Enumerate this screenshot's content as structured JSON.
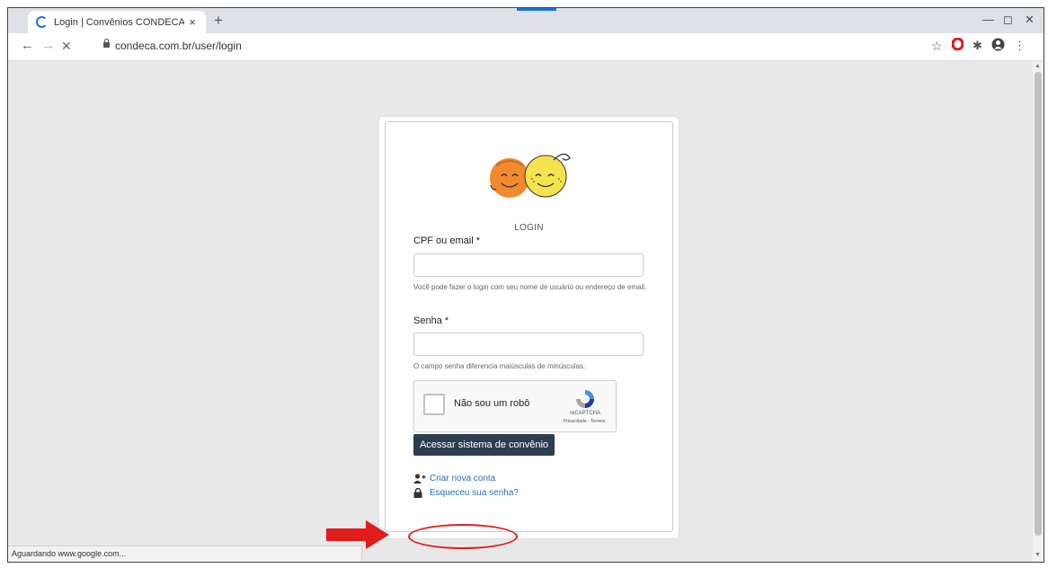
{
  "browser": {
    "tab_title": "Login | Convênios CONDECA",
    "tab_close": "×",
    "new_tab": "+",
    "url": "condeca.com.br/user/login",
    "status_text": "Aguardando www.google.com..."
  },
  "login": {
    "heading": "LOGIN",
    "cpf_label": "CPF ou email *",
    "cpf_value": "",
    "cpf_help": "Você pode fazer o login com seu nome de usuário ou endereço de email.",
    "senha_label": "Senha *",
    "senha_value": "",
    "senha_help": "O campo senha diferencia maiúsculas de minúsculas.",
    "submit_label": "Acessar sistema de convênio",
    "create_account_link": "Criar nova conta",
    "forgot_password_link": "Esqueceu sua senha?"
  },
  "recaptcha": {
    "label": "Não sou um robô",
    "brand": "reCAPTCHA",
    "links": "Privacidade - Termos"
  },
  "colors": {
    "annotation": "#e21b1b",
    "button": "#2c3e50",
    "link": "#2a6fb0",
    "loading": "#1a73e8"
  },
  "icons": [
    "spinner-icon",
    "back-arrow-icon",
    "forward-arrow-icon",
    "stop-icon",
    "lock-icon",
    "star-icon",
    "opera-icon",
    "extensions-icon",
    "profile-icon",
    "menu-icon",
    "user-plus-icon",
    "padlock-icon",
    "recaptcha-logo-icon",
    "red-arrow-icon"
  ]
}
